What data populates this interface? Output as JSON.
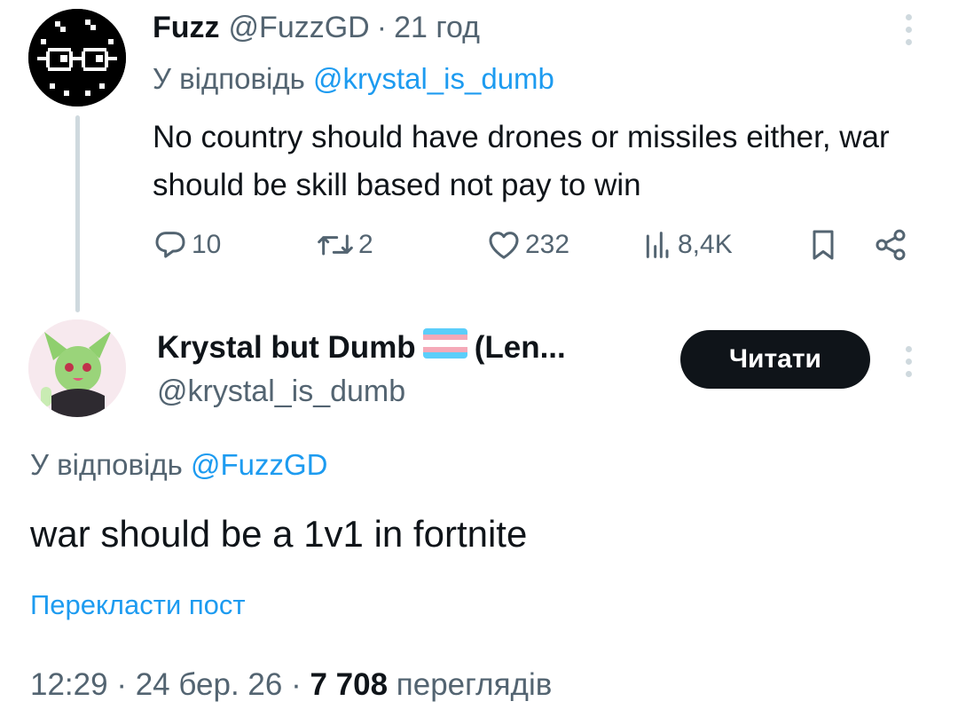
{
  "tweet1": {
    "display_name": "Fuzz",
    "handle": "@FuzzGD",
    "separator": "·",
    "time": "21 год",
    "reply_prefix": "У відповідь",
    "reply_mention": "@krystal_is_dumb",
    "text": "No country should have drones or missiles either, war should be skill based not pay to win",
    "stats": {
      "replies": "10",
      "reposts": "2",
      "likes": "232",
      "views": "8,4K"
    },
    "icons": [
      "reply-icon",
      "repost-icon",
      "like-icon",
      "views-icon",
      "bookmark-icon",
      "share-icon",
      "more-icon"
    ]
  },
  "tweet2": {
    "display_name": "Krystal but Dumb",
    "name_suffix": "(Len...",
    "handle": "@krystal_is_dumb",
    "follow_label": "Читати",
    "reply_prefix": "У відповідь",
    "reply_mention": "@FuzzGD",
    "text": "war should be a 1v1 in fortnite",
    "translate_label": "Перекласти пост",
    "meta": {
      "time": "12:29",
      "sep": "·",
      "date": "24 бер. 26",
      "views_count": "7 708",
      "views_label": "переглядів"
    }
  },
  "colors": {
    "text": "#0f1419",
    "secondary": "#536471",
    "link": "#1d9bf0",
    "thread_line": "#cfd9de",
    "button": "#0f1419"
  }
}
